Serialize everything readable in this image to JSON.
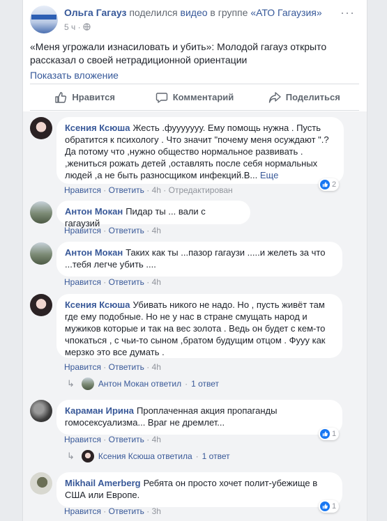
{
  "post": {
    "author": "Ольга Гагауз",
    "shared_text": "поделился",
    "video_link": "видео",
    "in_group_text": "в группе",
    "group": "«АТО Гагаузия»",
    "time": "5 ч",
    "privacy_icon": "globe-icon",
    "text": "«Меня угрожали изнасиловать и убить»: Молодой гагауз открыто рассказал о своей нетрадиционной ориентации",
    "show_attachment": "Показать вложение"
  },
  "actions": {
    "like": "Нравится",
    "comment": "Комментарий",
    "share": "Поделиться"
  },
  "comment_like_label": "Нравится",
  "comment_reply_label": "Ответить",
  "comments": [
    {
      "name": "Ксения Ксюша",
      "text": "Жесть .фууууууу. Ему помощь нужна . Пусть обратится к психологу . Что значит \"почему меня осуждают \".? Да потому что ,нужно общество нормальное развивать . ,жениться рожать детей ,оставлять после себя нормальных людей ,а не быть разносщиком инфекций.В...",
      "more": "Еще",
      "time": "4h",
      "edited": "Отредактирован",
      "reactions": "2"
    },
    {
      "name": "Антон Мокан",
      "text": "Пидар ты ... вали с гагаузий",
      "time": "4h"
    },
    {
      "name": "Антон Мокан",
      "text": "Таких как ты ...пазор гагаузи .....и желеть за что ...тебя легче убить ....",
      "time": "4h"
    },
    {
      "name": "Ксения Ксюша",
      "text": "Убивать никого не надо. Но , пусть живёт там где ему подобные. Но не у нас в стране смущать народ и мужиков которые и так на вес золота . Ведь он будет с кем-то чпокаться , с чьи-то сыном ,братом будущим отцом . Фууу как мерзко это все думать .",
      "time": "4h",
      "reply_author": "Антон Мокан",
      "reply_text": "ответил",
      "reply_count": "1 ответ"
    },
    {
      "name": "Караман Ирина",
      "text": "Проплаченная акция пропаганды гомосексуализма... Враг не дремлет...",
      "time": "4h",
      "reactions": "1",
      "reply_author": "Ксения Ксюша",
      "reply_text": "ответила",
      "reply_count": "1 ответ"
    },
    {
      "name": "Mikhail Amerberg",
      "text": "Ребята он просто хочет полит-убежище в США или Европе.",
      "time": "3h",
      "reactions": "1"
    }
  ]
}
